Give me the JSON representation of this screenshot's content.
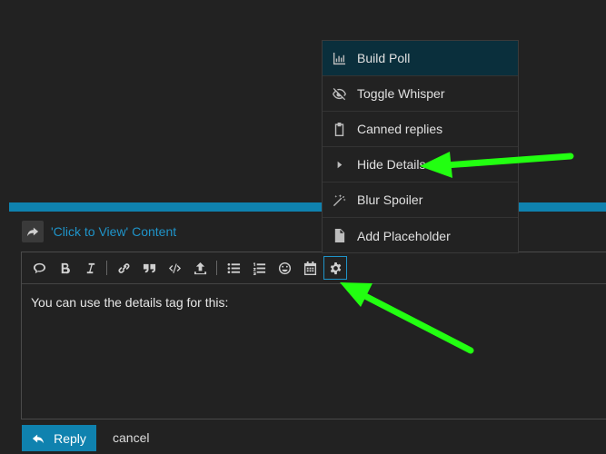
{
  "composer": {
    "reply_to_title": "'Click to View' Content",
    "body_text": "You can use the details tag for this:",
    "reply_label": "Reply",
    "cancel_label": "cancel"
  },
  "toolbar": {
    "buttons": [
      {
        "name": "quote-icon"
      },
      {
        "name": "bold-icon"
      },
      {
        "name": "italic-icon"
      },
      {
        "name": "link-icon"
      },
      {
        "name": "blockquote-icon"
      },
      {
        "name": "code-icon"
      },
      {
        "name": "upload-icon"
      },
      {
        "name": "bullet-list-icon"
      },
      {
        "name": "numbered-list-icon"
      },
      {
        "name": "emoji-icon"
      },
      {
        "name": "calendar-icon"
      },
      {
        "name": "gear-icon",
        "active": true
      }
    ]
  },
  "popup_menu": {
    "items": [
      {
        "label": "Build Poll",
        "icon": "chart-icon",
        "highlighted": true
      },
      {
        "label": "Toggle Whisper",
        "icon": "eye-slash-icon"
      },
      {
        "label": "Canned replies",
        "icon": "clipboard-icon"
      },
      {
        "label": "Hide Details",
        "icon": "caret-right-icon"
      },
      {
        "label": "Blur Spoiler",
        "icon": "magic-icon"
      },
      {
        "label": "Add Placeholder",
        "icon": "file-icon"
      }
    ]
  },
  "colors": {
    "background": "#222222",
    "accent": "#0f82af",
    "link": "#1f94c9",
    "menu_highlight": "#0a2f3c",
    "annotation_arrow": "#22ff11"
  }
}
